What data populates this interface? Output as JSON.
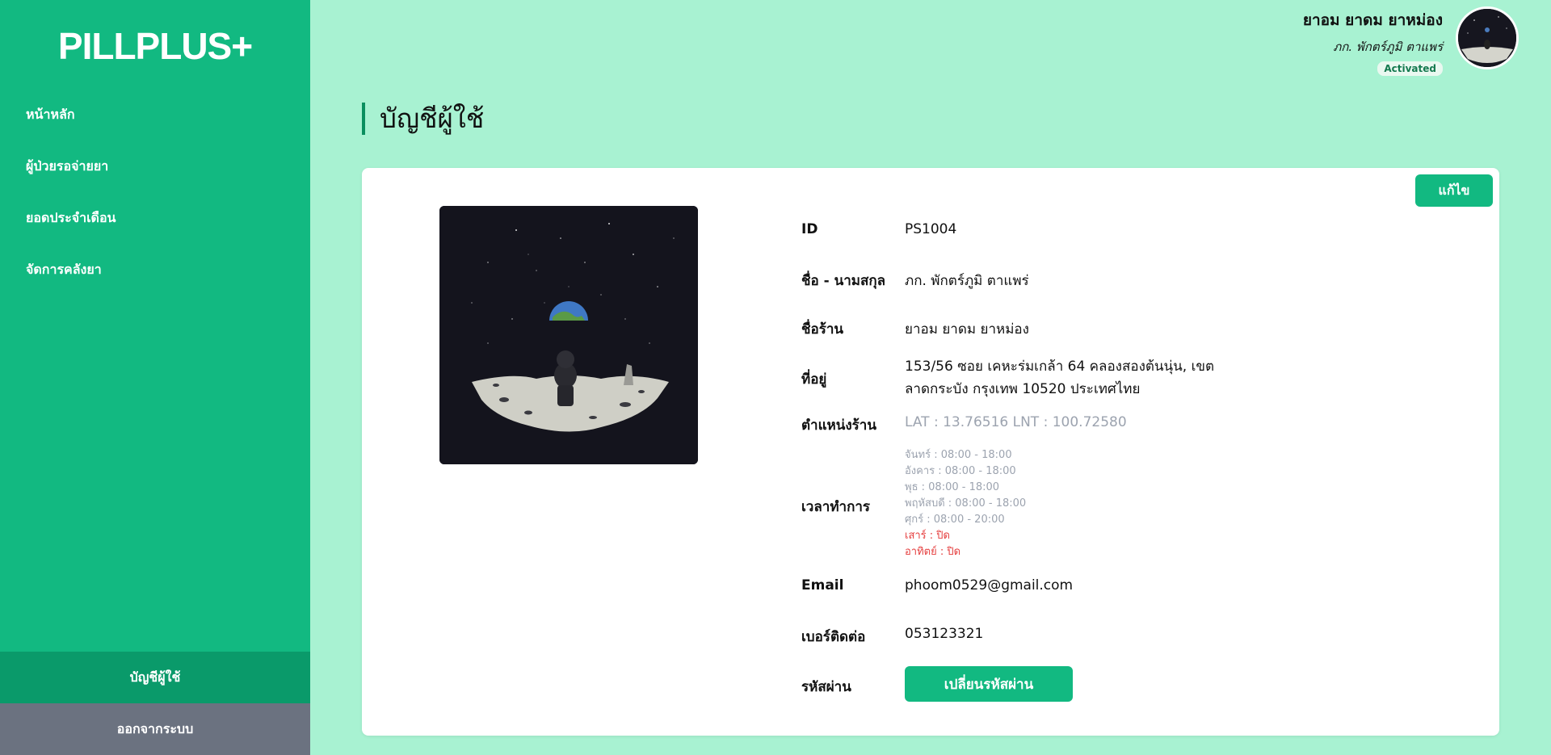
{
  "app": {
    "logo": "PILLPLUS+"
  },
  "sidebar": {
    "items": [
      {
        "label": "หน้าหลัก"
      },
      {
        "label": "ผู้ป่วยรอจ่ายยา"
      },
      {
        "label": "ยอดประจำเดือน"
      },
      {
        "label": "จัดการคลังยา"
      }
    ],
    "account_label": "บัญชีผู้ใช้",
    "logout_label": "ออกจากระบบ"
  },
  "header": {
    "user_name": "ยาอม ยาดม ยาหม่อง",
    "user_sub": "ภก. พักตร์ภูมิ ตาแพร่",
    "status": "Activated",
    "avatar_icon": "astronaut-avatar"
  },
  "page": {
    "title": "บัญชีผู้ใช้",
    "edit_label": "แก้ไข"
  },
  "profile": {
    "id_label": "ID",
    "id": "PS1004",
    "name_label": "ชื่อ - นามสกุล",
    "name": "ภก. พักตร์ภูมิ ตาแพร่",
    "shop_label": "ชื่อร้าน",
    "shop": "ยาอม ยาดม ยาหม่อง",
    "address_label": "ที่อยู่",
    "address_line1": "153/56 ซอย เคหะร่มเกล้า 64 คลองสองต้นนุ่น, เขต",
    "address_line2": "ลาดกระบัง กรุงเทพ 10520 ประเทศไทย",
    "location_label": "ตำแหน่งร้าน",
    "location": "LAT : 13.76516  LNT : 100.72580",
    "hours_label": "เวลาทำการ",
    "hours": [
      "จันทร์ : 08:00 - 18:00",
      "อังคาร : 08:00 - 18:00",
      "พุธ : 08:00 - 18:00",
      "พฤหัสบดี : 08:00 - 18:00",
      "ศุกร์ : 08:00 - 20:00",
      "เสาร์ : ปิด",
      "อาทิตย์ : ปิด"
    ],
    "email_label": "Email",
    "email": "phoom0529@gmail.com",
    "phone_label": "เบอร์ติดต่อ",
    "phone": "053123321",
    "password_label": "รหัสผ่าน",
    "password_button": "เปลี่ยนรหัสผ่าน",
    "photo_icon": "astronaut-moon-image"
  },
  "colors": {
    "accent": "#12b981",
    "background": "#a8f2d2",
    "closed": "#e53e3e"
  }
}
